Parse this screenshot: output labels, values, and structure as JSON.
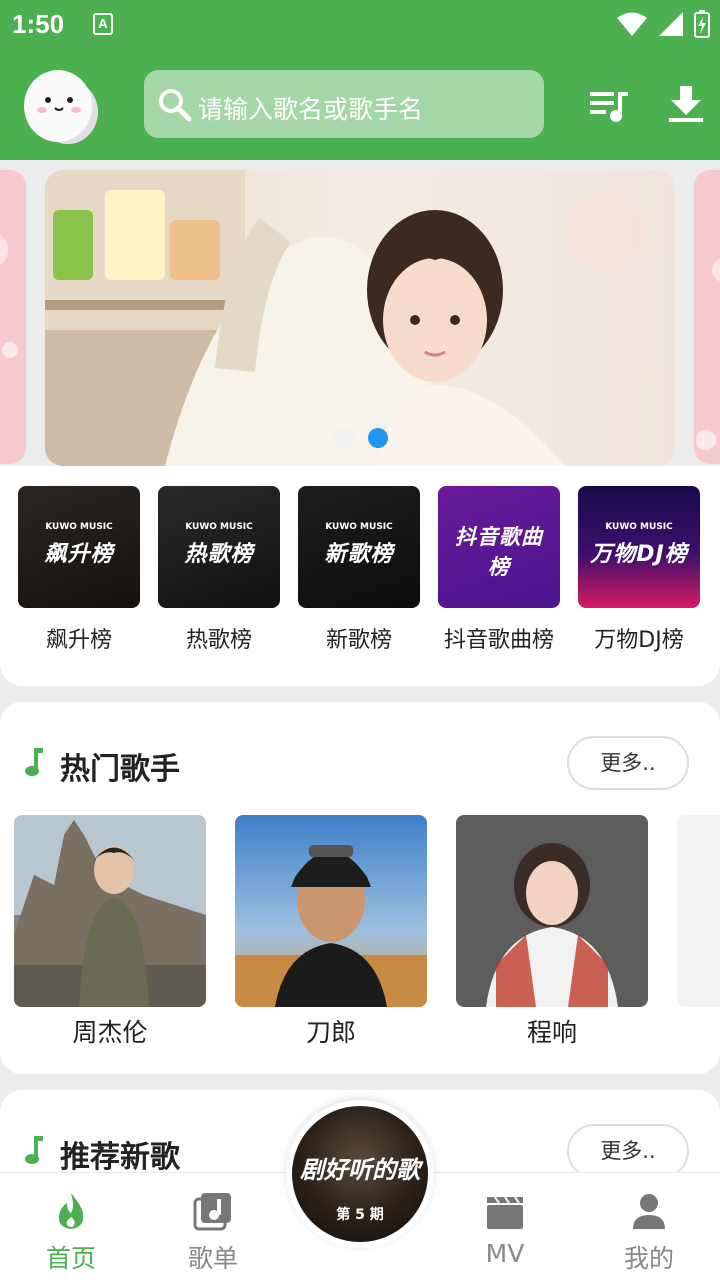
{
  "status_bar": {
    "time": "1:50",
    "notification_icon_letter": "A"
  },
  "header": {
    "search_placeholder": "请输入歌名或歌手名",
    "accent_color": "#4caf50"
  },
  "banner": {
    "page_count": 2,
    "active_index": 1
  },
  "charts": [
    {
      "label": "飙升榜",
      "cover_title": "飙升榜",
      "cover_brand": "KUWO MUSIC"
    },
    {
      "label": "热歌榜",
      "cover_title": "热歌榜",
      "cover_brand": "KUWO MUSIC"
    },
    {
      "label": "新歌榜",
      "cover_title": "新歌榜",
      "cover_brand": "KUWO MUSIC"
    },
    {
      "label": "抖音歌曲榜",
      "cover_title": "抖音歌曲榜",
      "cover_brand": ""
    },
    {
      "label": "万物DJ榜",
      "cover_title": "万物DJ榜",
      "cover_brand": "KUWO MUSIC"
    }
  ],
  "hot_singers": {
    "title": "热门歌手",
    "more_label": "更多..",
    "singers": [
      {
        "name": "周杰伦"
      },
      {
        "name": "刀郎"
      },
      {
        "name": "程响"
      }
    ]
  },
  "new_songs": {
    "title": "推荐新歌",
    "more_label": "更多.."
  },
  "now_playing": {
    "title": "剧好听的歌",
    "episode": "第 5 期"
  },
  "bottom_nav": [
    {
      "label": "首页",
      "icon": "flame-icon",
      "active": true
    },
    {
      "label": "歌单",
      "icon": "music-library-icon",
      "active": false
    },
    {
      "label": "MV",
      "icon": "clapperboard-icon",
      "active": false
    },
    {
      "label": "我的",
      "icon": "person-icon",
      "active": false
    }
  ]
}
